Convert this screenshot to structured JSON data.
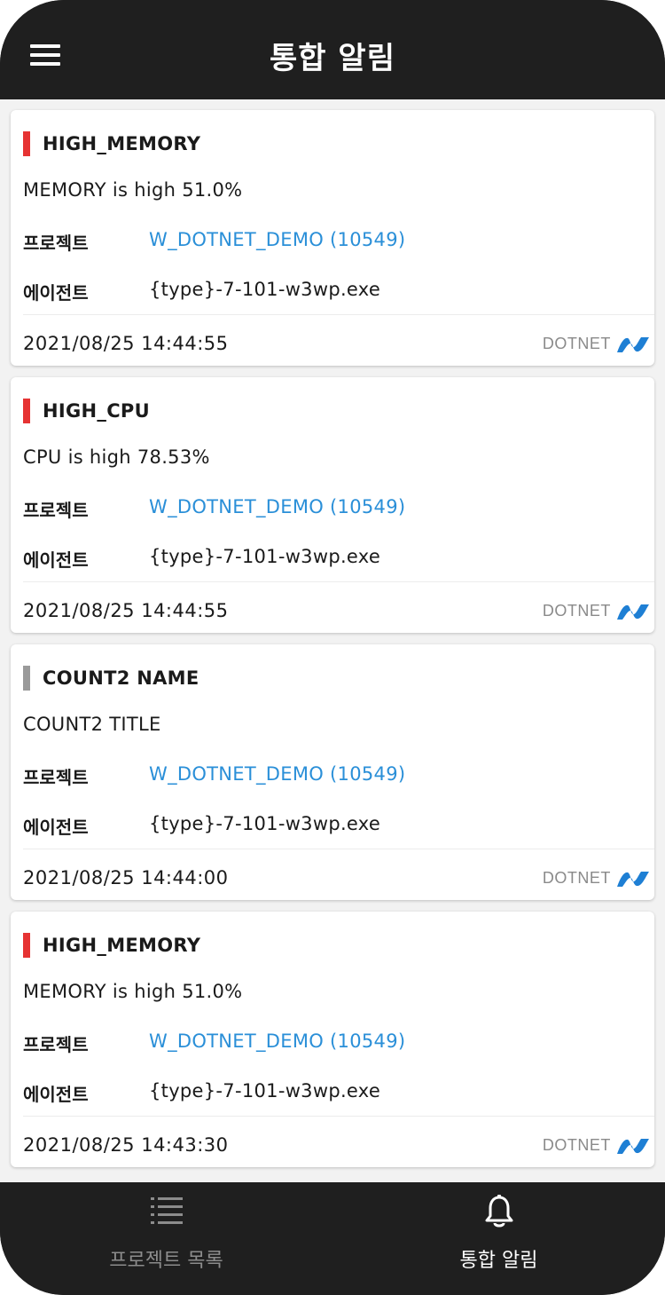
{
  "header": {
    "title": "통합 알림"
  },
  "labels": {
    "project": "프로젝트",
    "agent": "에이전트"
  },
  "colors": {
    "level_warning": "#e63333",
    "level_info": "#9a9a9a",
    "link": "#2a8fd8",
    "dotnet_logo": "#1e7fd4"
  },
  "alerts": [
    {
      "name": "HIGH_MEMORY",
      "level_color": "#e63333",
      "title": "MEMORY is high 51.0%",
      "project": "W_DOTNET_DEMO (10549)",
      "agent": "{type}-7-101-w3wp.exe",
      "time": "2021/08/25 14:44:55",
      "platform": "DOTNET"
    },
    {
      "name": "HIGH_CPU",
      "level_color": "#e63333",
      "title": "CPU is high 78.53%",
      "project": "W_DOTNET_DEMO (10549)",
      "agent": "{type}-7-101-w3wp.exe",
      "time": "2021/08/25 14:44:55",
      "platform": "DOTNET"
    },
    {
      "name": "COUNT2 NAME",
      "level_color": "#9a9a9a",
      "title": "COUNT2 TITLE",
      "project": "W_DOTNET_DEMO (10549)",
      "agent": "{type}-7-101-w3wp.exe",
      "time": "2021/08/25 14:44:00",
      "platform": "DOTNET"
    },
    {
      "name": "HIGH_MEMORY",
      "level_color": "#e63333",
      "title": "MEMORY is high 51.0%",
      "project": "W_DOTNET_DEMO (10549)",
      "agent": "{type}-7-101-w3wp.exe",
      "time": "2021/08/25 14:43:30",
      "platform": "DOTNET"
    }
  ],
  "tabbar": {
    "tabs": [
      {
        "label": "프로젝트 목록",
        "icon": "list-icon",
        "active": false,
        "color": "#8c8c8c"
      },
      {
        "label": "통합 알림",
        "icon": "bell-icon",
        "active": true,
        "color": "#ffffff"
      }
    ]
  }
}
